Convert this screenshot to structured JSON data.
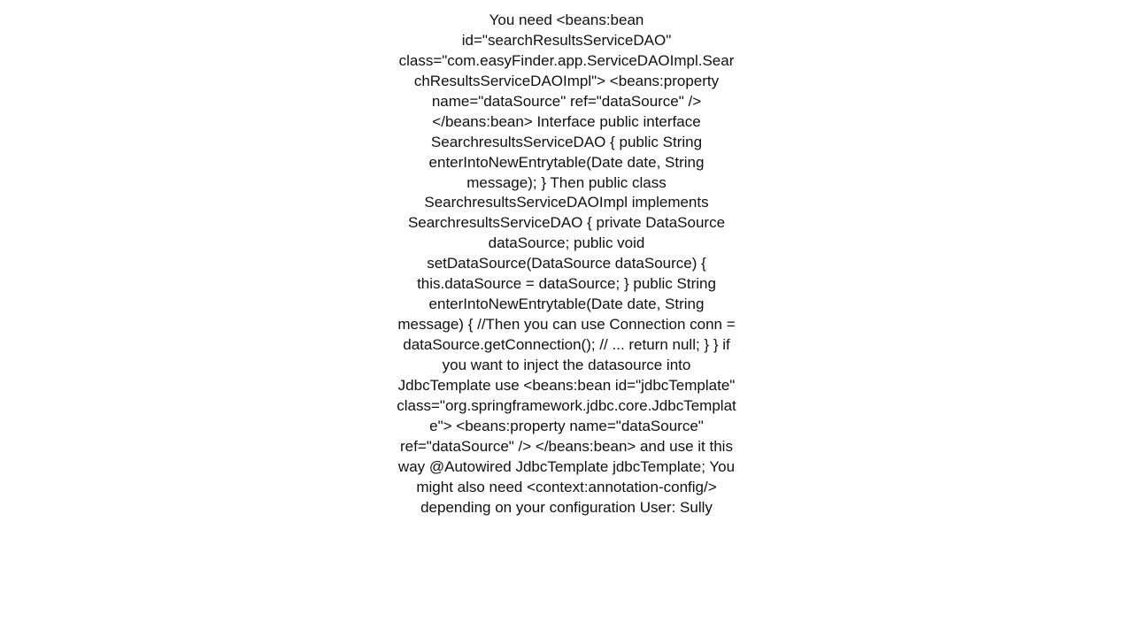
{
  "content": {
    "text": "You need <beans:bean id=\"searchResultsServiceDAO\"  class=\"com.easyFinder.app.ServiceDAOImpl.SearchResultsServiceDAOImpl\">      <beans:property name=\"dataSource\"  ref=\"dataSource\" />   </beans:bean>  Interface public interface SearchresultsServiceDAO {       public String enterIntoNewEntrytable(Date date, String message); }  Then public class SearchresultsServiceDAOImpl implements SearchresultsServiceDAO {      private DataSource dataSource;      public void setDataSource(DataSource dataSource) {         this.dataSource = dataSource;     }      public String enterIntoNewEntrytable(Date date, String message) {         //Then you can use          Connection conn = dataSource.getConnection();         // ...         return null;     }  }  if you want to inject the datasource into JdbcTemplate use <beans:bean id=\"jdbcTemplate\" class=\"org.springframework.jdbc.core.JdbcTemplate\">     <beans:property name=\"dataSource\" ref=\"dataSource\" /> </beans:bean>   and use it this way @Autowired  JdbcTemplate jdbcTemplate;  You might also need <context:annotation-config/> depending on your configuration   User: Sully"
  }
}
